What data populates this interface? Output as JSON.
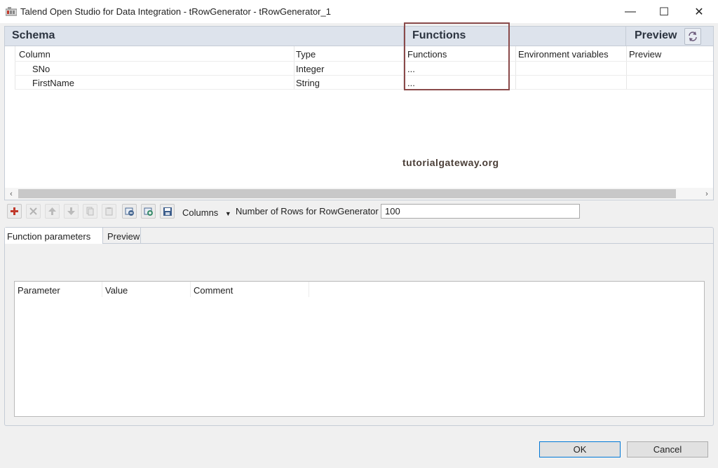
{
  "window": {
    "title": "Talend Open Studio for Data Integration - tRowGenerator - tRowGenerator_1",
    "minimize_glyph": "—",
    "maximize_glyph": "☐",
    "close_glyph": "✕"
  },
  "header": {
    "schema": "Schema",
    "functions": "Functions",
    "preview": "Preview"
  },
  "schema_table": {
    "columns": [
      "Column",
      "Type",
      "Functions",
      "Environment variables",
      "Preview"
    ],
    "rows": [
      {
        "column": "SNo",
        "type": "Integer",
        "functions": "..."
      },
      {
        "column": "FirstName",
        "type": "String",
        "functions": "..."
      }
    ]
  },
  "watermark": "tutorialgateway.org",
  "toolbar": {
    "columns_label": "Columns",
    "rows_label": "Number of Rows for RowGenerator",
    "rows_value": "100"
  },
  "lower_tabs": [
    "Function parameters",
    "Preview"
  ],
  "params_table": {
    "columns": [
      "Parameter",
      "Value",
      "Comment"
    ]
  },
  "buttons": {
    "ok": "OK",
    "cancel": "Cancel"
  },
  "colors": {
    "header_band": "#dde3ec",
    "highlight_box": "#8a4a4a"
  }
}
